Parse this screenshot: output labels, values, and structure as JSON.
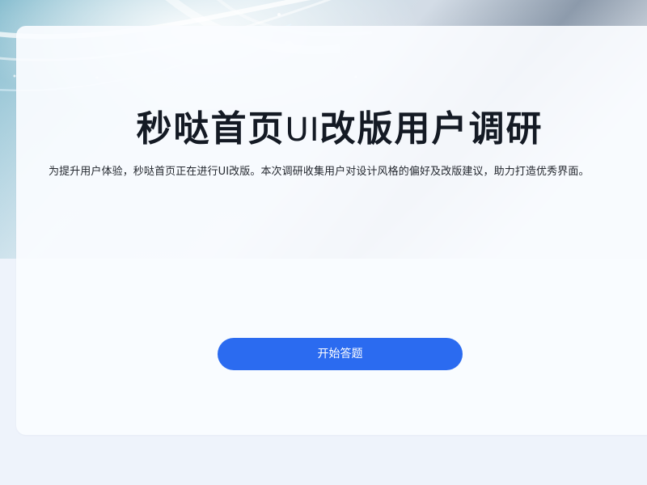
{
  "hero": {
    "title_part1": "秒哒首页",
    "title_part2": "UI",
    "title_part3": "改版用户调研",
    "subtitle": "为提升用户体验，秒哒首页正在进行UI改版。本次调研收集用户对设计风格的偏好及改版建议，助力打造优秀界面。"
  },
  "actions": {
    "start_label": "开始答题"
  },
  "colors": {
    "primary": "#2b6bf0",
    "title": "#141a24",
    "page_background": "#eef3fb"
  }
}
